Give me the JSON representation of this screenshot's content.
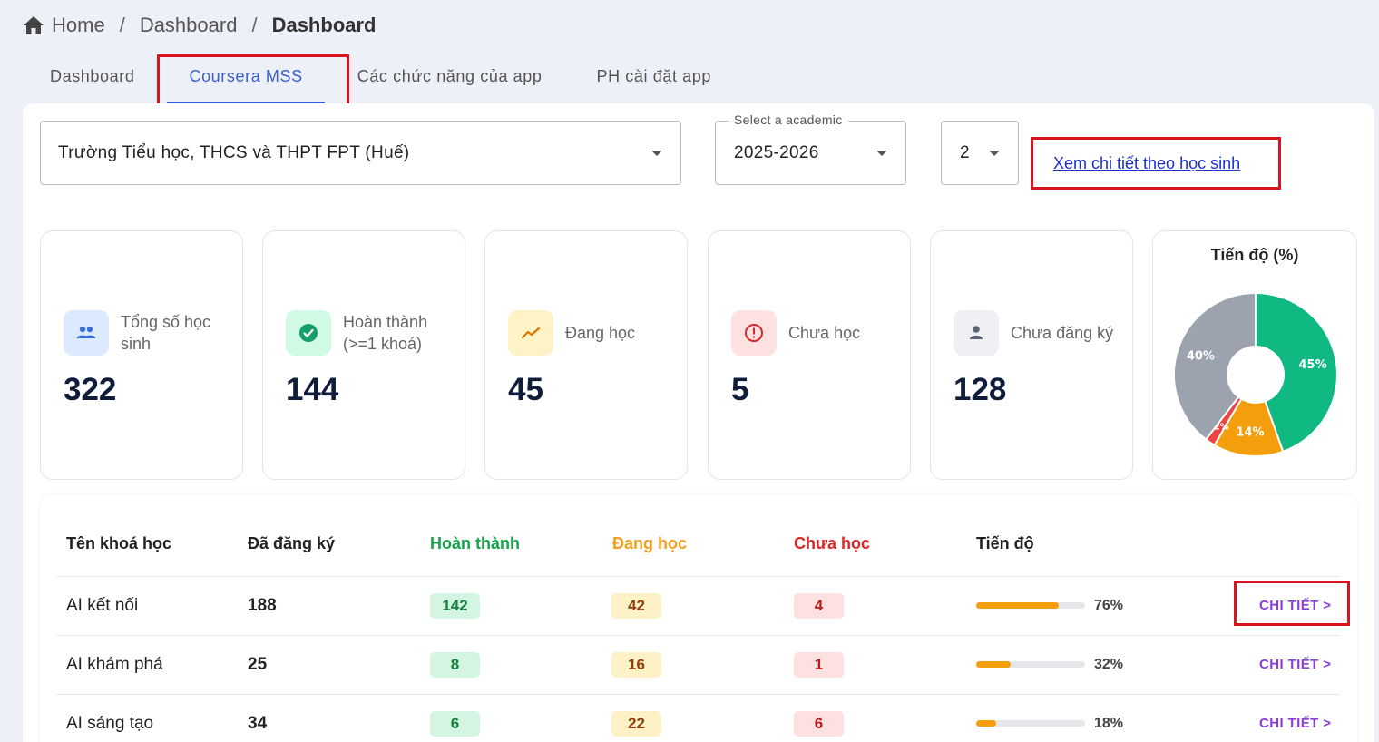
{
  "breadcrumb": {
    "home": "Home",
    "sep1": "/",
    "level1": "Dashboard",
    "sep2": "/",
    "current": "Dashboard"
  },
  "tabs": [
    {
      "label": "Dashboard"
    },
    {
      "label": "Coursera MSS"
    },
    {
      "label": "Các chức năng của app"
    },
    {
      "label": "PH cài đặt app"
    }
  ],
  "filters": {
    "school": "Trường Tiểu học, THCS và THPT FPT (Huế)",
    "academic_legend": "Select a academic",
    "academic_year": "2025-2026",
    "term": "2"
  },
  "detail_link": "Xem chi tiết theo học sinh",
  "cards": [
    {
      "label": "Tổng số học sinh",
      "value": "322",
      "icon": "users-icon"
    },
    {
      "label": "Hoàn thành (>=1 khoá)",
      "value": "144",
      "icon": "check-circle-icon"
    },
    {
      "label": "Đang học",
      "value": "45",
      "icon": "trending-icon"
    },
    {
      "label": "Chưa học",
      "value": "5",
      "icon": "alert-circle-icon"
    },
    {
      "label": "Chưa đăng ký",
      "value": "128",
      "icon": "person-icon"
    }
  ],
  "chart_data": {
    "type": "pie",
    "title": "Tiến độ (%)",
    "categories": [
      "Hoàn thành",
      "Đang học",
      "Chưa học",
      "Chưa đăng ký"
    ],
    "values": [
      45,
      14,
      2,
      40
    ],
    "labels": [
      "45%",
      "14%",
      "2%",
      "40%"
    ],
    "colors": [
      "#10b981",
      "#f59e0b",
      "#ef4444",
      "#9ca3af"
    ],
    "donut": true
  },
  "table": {
    "headers": {
      "course": "Tên khoá học",
      "registered": "Đã đăng ký",
      "completed": "Hoàn thành",
      "studying": "Đang học",
      "not_started": "Chưa học",
      "progress": "Tiến độ"
    },
    "header_colors": {
      "completed": "#16a34a",
      "studying": "#f0a020",
      "not_started": "#dc2626"
    },
    "rows": [
      {
        "course": "AI kết nối",
        "registered": "188",
        "completed": "142",
        "studying": "42",
        "not_started": "4",
        "progress_pct": 76,
        "progress_label": "76%",
        "action": "CHI TIẾT >"
      },
      {
        "course": "AI khám phá",
        "registered": "25",
        "completed": "8",
        "studying": "16",
        "not_started": "1",
        "progress_pct": 32,
        "progress_label": "32%",
        "action": "CHI TIẾT >"
      },
      {
        "course": "AI sáng tạo",
        "registered": "34",
        "completed": "6",
        "studying": "22",
        "not_started": "6",
        "progress_pct": 18,
        "progress_label": "18%",
        "action": "CHI TIẾT >"
      }
    ]
  }
}
